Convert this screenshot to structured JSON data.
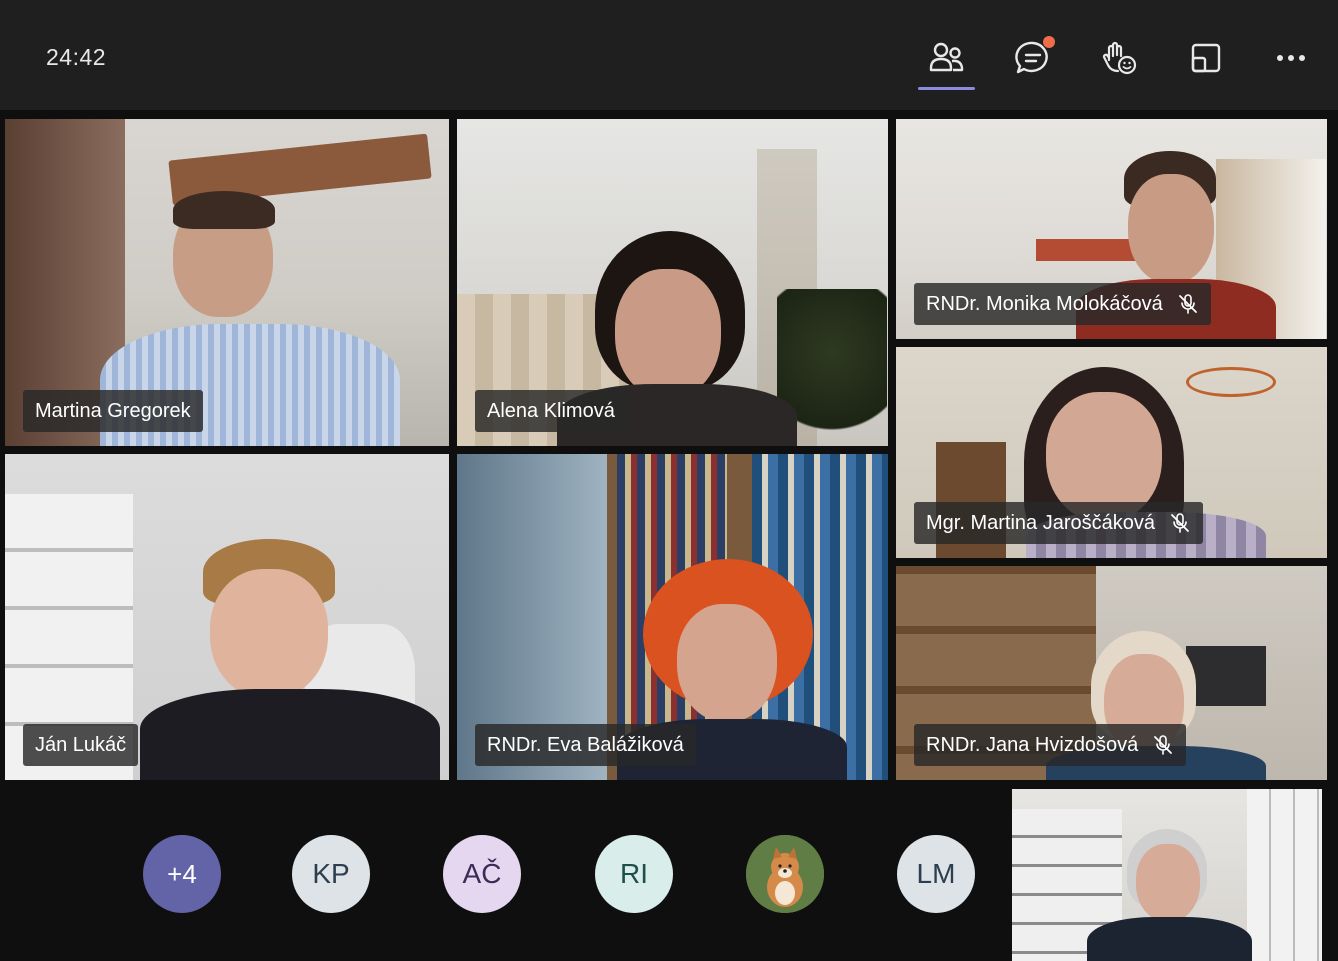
{
  "meeting": {
    "timer": "24:42"
  },
  "toolbar": {
    "people_label": "",
    "chat_label": "",
    "reactions_label": "",
    "rooms_label": "",
    "more_label": "",
    "accent": "#8b8cdb",
    "notification_color": "#f06d4b"
  },
  "participants": [
    {
      "name": "Martina Gregorek",
      "muted": false
    },
    {
      "name": "Alena Klimová",
      "muted": false
    },
    {
      "name": "RNDr. Monika Molokáčová",
      "muted": true
    },
    {
      "name": "Mgr. Martina Jaroščáková",
      "muted": true
    },
    {
      "name": "Ján Lukáč",
      "muted": false
    },
    {
      "name": "RNDr. Eva Balážiková",
      "muted": false
    },
    {
      "name": "RNDr. Jana Hvizdošová",
      "muted": true
    }
  ],
  "overflow": {
    "more_count": "+4",
    "avatars": [
      "KP",
      "AČ",
      "RI",
      "",
      "LM"
    ]
  }
}
